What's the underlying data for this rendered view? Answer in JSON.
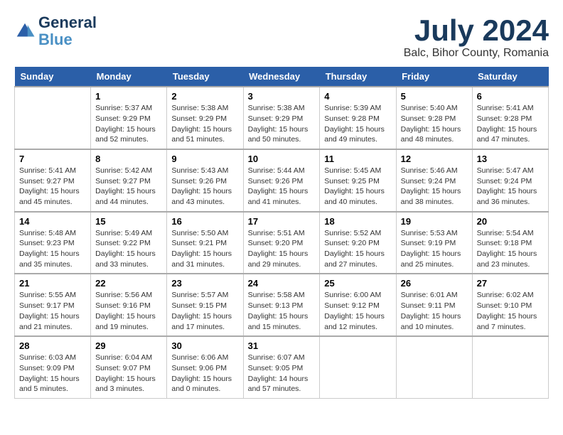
{
  "app": {
    "logo_line1": "General",
    "logo_line2": "Blue"
  },
  "title": "July 2024",
  "subtitle": "Balc, Bihor County, Romania",
  "days_header": [
    "Sunday",
    "Monday",
    "Tuesday",
    "Wednesday",
    "Thursday",
    "Friday",
    "Saturday"
  ],
  "weeks": [
    [
      {
        "num": "",
        "detail": ""
      },
      {
        "num": "1",
        "detail": "Sunrise: 5:37 AM\nSunset: 9:29 PM\nDaylight: 15 hours\nand 52 minutes."
      },
      {
        "num": "2",
        "detail": "Sunrise: 5:38 AM\nSunset: 9:29 PM\nDaylight: 15 hours\nand 51 minutes."
      },
      {
        "num": "3",
        "detail": "Sunrise: 5:38 AM\nSunset: 9:29 PM\nDaylight: 15 hours\nand 50 minutes."
      },
      {
        "num": "4",
        "detail": "Sunrise: 5:39 AM\nSunset: 9:28 PM\nDaylight: 15 hours\nand 49 minutes."
      },
      {
        "num": "5",
        "detail": "Sunrise: 5:40 AM\nSunset: 9:28 PM\nDaylight: 15 hours\nand 48 minutes."
      },
      {
        "num": "6",
        "detail": "Sunrise: 5:41 AM\nSunset: 9:28 PM\nDaylight: 15 hours\nand 47 minutes."
      }
    ],
    [
      {
        "num": "7",
        "detail": "Sunrise: 5:41 AM\nSunset: 9:27 PM\nDaylight: 15 hours\nand 45 minutes."
      },
      {
        "num": "8",
        "detail": "Sunrise: 5:42 AM\nSunset: 9:27 PM\nDaylight: 15 hours\nand 44 minutes."
      },
      {
        "num": "9",
        "detail": "Sunrise: 5:43 AM\nSunset: 9:26 PM\nDaylight: 15 hours\nand 43 minutes."
      },
      {
        "num": "10",
        "detail": "Sunrise: 5:44 AM\nSunset: 9:26 PM\nDaylight: 15 hours\nand 41 minutes."
      },
      {
        "num": "11",
        "detail": "Sunrise: 5:45 AM\nSunset: 9:25 PM\nDaylight: 15 hours\nand 40 minutes."
      },
      {
        "num": "12",
        "detail": "Sunrise: 5:46 AM\nSunset: 9:24 PM\nDaylight: 15 hours\nand 38 minutes."
      },
      {
        "num": "13",
        "detail": "Sunrise: 5:47 AM\nSunset: 9:24 PM\nDaylight: 15 hours\nand 36 minutes."
      }
    ],
    [
      {
        "num": "14",
        "detail": "Sunrise: 5:48 AM\nSunset: 9:23 PM\nDaylight: 15 hours\nand 35 minutes."
      },
      {
        "num": "15",
        "detail": "Sunrise: 5:49 AM\nSunset: 9:22 PM\nDaylight: 15 hours\nand 33 minutes."
      },
      {
        "num": "16",
        "detail": "Sunrise: 5:50 AM\nSunset: 9:21 PM\nDaylight: 15 hours\nand 31 minutes."
      },
      {
        "num": "17",
        "detail": "Sunrise: 5:51 AM\nSunset: 9:20 PM\nDaylight: 15 hours\nand 29 minutes."
      },
      {
        "num": "18",
        "detail": "Sunrise: 5:52 AM\nSunset: 9:20 PM\nDaylight: 15 hours\nand 27 minutes."
      },
      {
        "num": "19",
        "detail": "Sunrise: 5:53 AM\nSunset: 9:19 PM\nDaylight: 15 hours\nand 25 minutes."
      },
      {
        "num": "20",
        "detail": "Sunrise: 5:54 AM\nSunset: 9:18 PM\nDaylight: 15 hours\nand 23 minutes."
      }
    ],
    [
      {
        "num": "21",
        "detail": "Sunrise: 5:55 AM\nSunset: 9:17 PM\nDaylight: 15 hours\nand 21 minutes."
      },
      {
        "num": "22",
        "detail": "Sunrise: 5:56 AM\nSunset: 9:16 PM\nDaylight: 15 hours\nand 19 minutes."
      },
      {
        "num": "23",
        "detail": "Sunrise: 5:57 AM\nSunset: 9:15 PM\nDaylight: 15 hours\nand 17 minutes."
      },
      {
        "num": "24",
        "detail": "Sunrise: 5:58 AM\nSunset: 9:13 PM\nDaylight: 15 hours\nand 15 minutes."
      },
      {
        "num": "25",
        "detail": "Sunrise: 6:00 AM\nSunset: 9:12 PM\nDaylight: 15 hours\nand 12 minutes."
      },
      {
        "num": "26",
        "detail": "Sunrise: 6:01 AM\nSunset: 9:11 PM\nDaylight: 15 hours\nand 10 minutes."
      },
      {
        "num": "27",
        "detail": "Sunrise: 6:02 AM\nSunset: 9:10 PM\nDaylight: 15 hours\nand 7 minutes."
      }
    ],
    [
      {
        "num": "28",
        "detail": "Sunrise: 6:03 AM\nSunset: 9:09 PM\nDaylight: 15 hours\nand 5 minutes."
      },
      {
        "num": "29",
        "detail": "Sunrise: 6:04 AM\nSunset: 9:07 PM\nDaylight: 15 hours\nand 3 minutes."
      },
      {
        "num": "30",
        "detail": "Sunrise: 6:06 AM\nSunset: 9:06 PM\nDaylight: 15 hours\nand 0 minutes."
      },
      {
        "num": "31",
        "detail": "Sunrise: 6:07 AM\nSunset: 9:05 PM\nDaylight: 14 hours\nand 57 minutes."
      },
      {
        "num": "",
        "detail": ""
      },
      {
        "num": "",
        "detail": ""
      },
      {
        "num": "",
        "detail": ""
      }
    ]
  ]
}
